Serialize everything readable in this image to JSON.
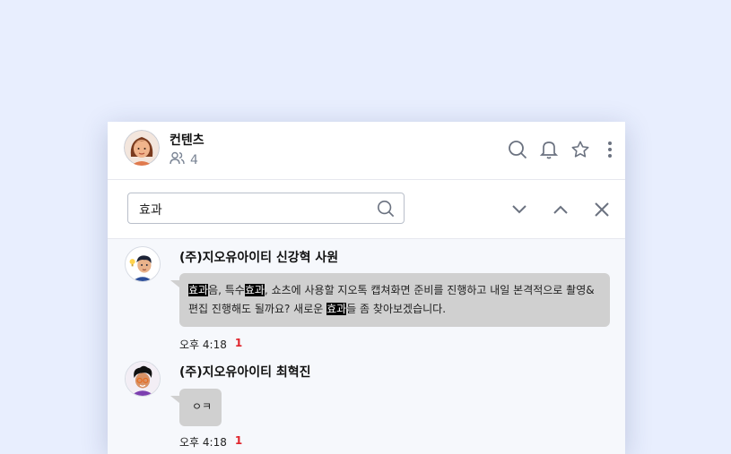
{
  "header": {
    "title": "컨텐츠",
    "member_count": "4",
    "icons": [
      "search-icon",
      "bell-icon",
      "star-icon",
      "more-vertical-icon"
    ]
  },
  "search": {
    "value": "효과",
    "icons": [
      "search-icon",
      "chevron-down-icon",
      "chevron-up-icon",
      "close-icon"
    ]
  },
  "messages": [
    {
      "sender": "(주)지오유아이티 신강혁 사원",
      "segments": [
        {
          "text": "효과",
          "highlight": true
        },
        {
          "text": "음, 특수",
          "highlight": false
        },
        {
          "text": "효과",
          "highlight": true
        },
        {
          "text": ", 쇼츠에 사용할 지오톡 캡쳐화면 준비를 진행하고 내일 본격적으로 촬영&편집 진행해도 될까요? 새로운 ",
          "highlight": false
        },
        {
          "text": "효과",
          "highlight": true
        },
        {
          "text": "들 좀 찾아보겠습니다.",
          "highlight": false
        }
      ],
      "time": "오후 4:18",
      "unread": "1"
    },
    {
      "sender": "(주)지오유아이티 최혁진",
      "segments": [
        {
          "text": "ㅇㅋ",
          "highlight": false
        }
      ],
      "time": "오후 4:18",
      "unread": "1"
    }
  ],
  "colors": {
    "background": "#e8eefe",
    "bubble": "#d0d0d0",
    "unread": "#e0242c",
    "icon": "#6b7280"
  }
}
